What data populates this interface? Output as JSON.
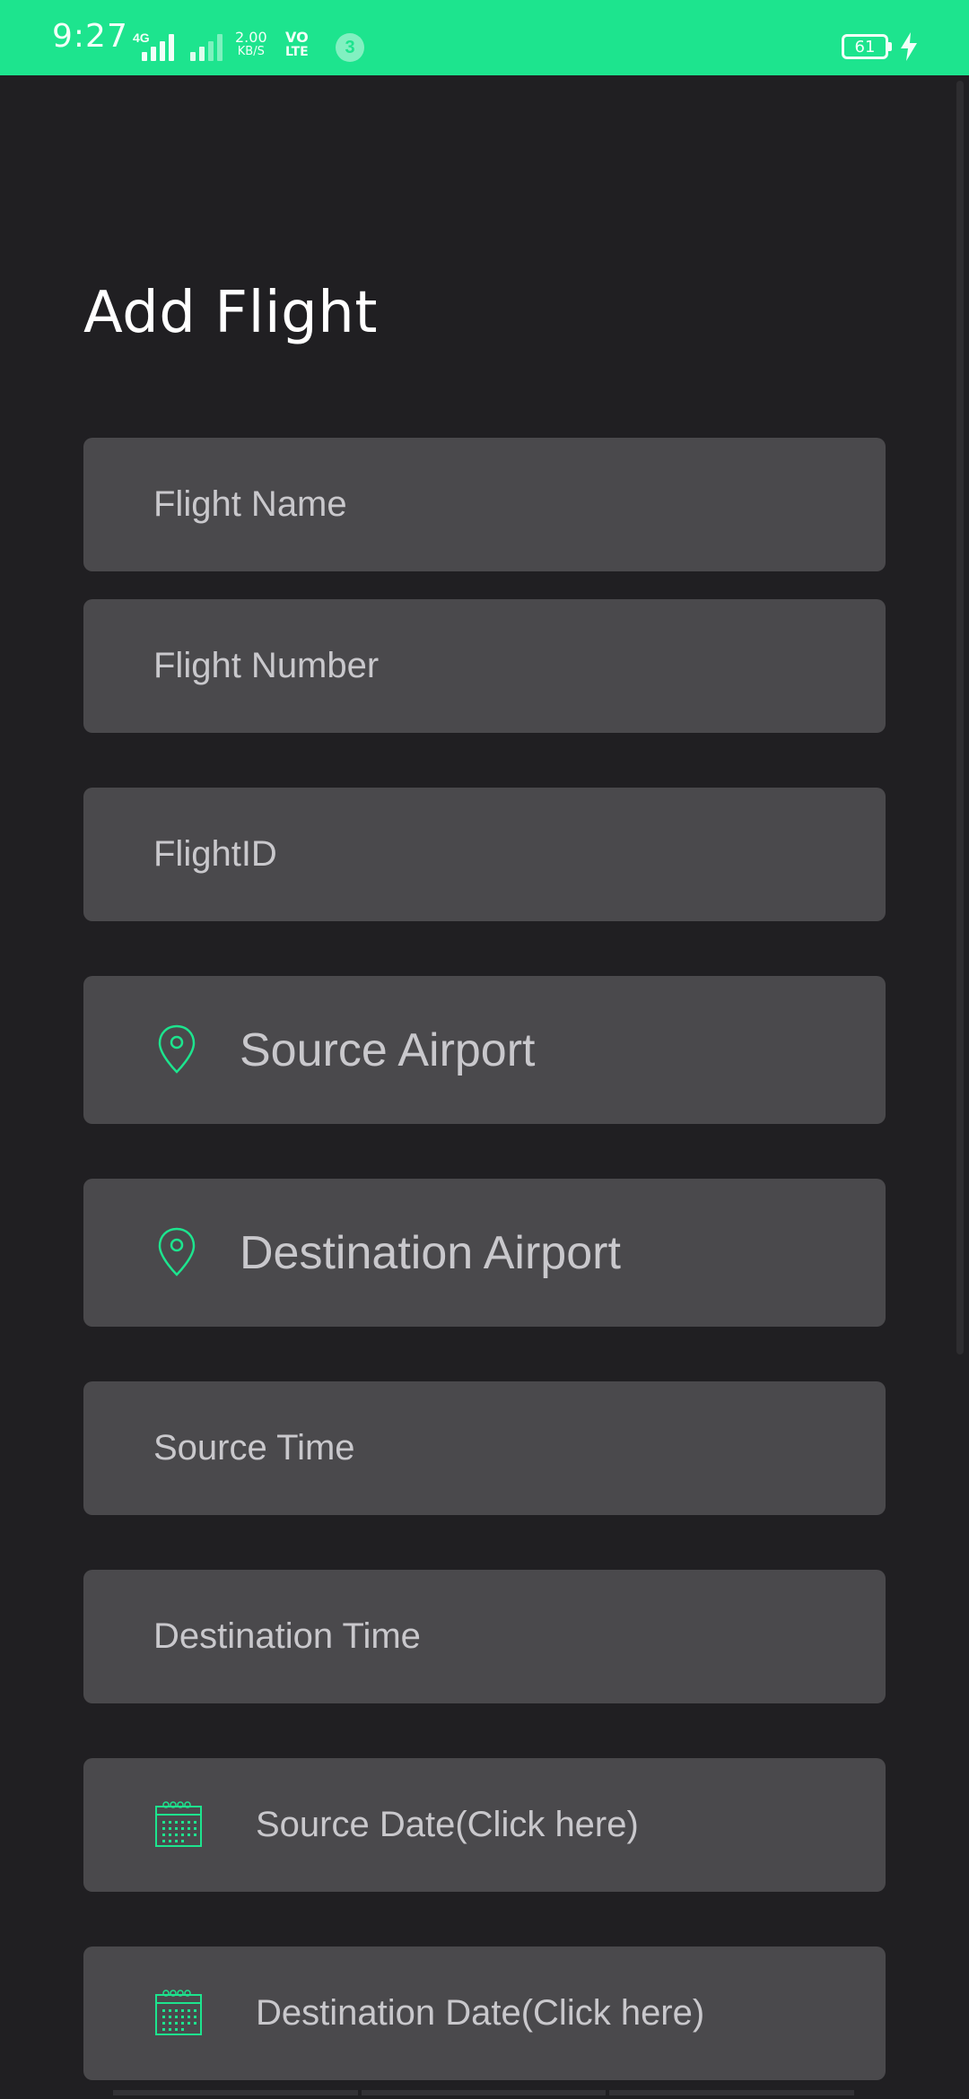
{
  "status_bar": {
    "time": "9:27",
    "network": "4G",
    "speed_value": "2.00",
    "speed_unit": "KB/S",
    "volte_top": "VO",
    "volte_bottom": "LTE",
    "notification_count": "3",
    "battery": "61",
    "accent_color": "#1de48e"
  },
  "page": {
    "title": "Add Flight"
  },
  "form": {
    "flight_name": {
      "placeholder": "Flight Name"
    },
    "flight_number": {
      "placeholder": "Flight Number"
    },
    "flight_id": {
      "placeholder": "FlightID"
    },
    "source_airport": {
      "placeholder": "Source Airport",
      "icon": "location-pin-icon"
    },
    "destination_airport": {
      "placeholder": "Destination Airport",
      "icon": "location-pin-icon"
    },
    "source_time": {
      "placeholder": "Source Time"
    },
    "destination_time": {
      "placeholder": "Destination Time"
    },
    "source_date": {
      "placeholder": "Source Date(Click here)",
      "icon": "calendar-icon"
    },
    "destination_date": {
      "placeholder": "Destination Date(Click here)",
      "icon": "calendar-icon"
    }
  },
  "colors": {
    "background": "#201f22",
    "field": "#4a494c",
    "field_text": "#c9c8cc",
    "icon": "#1de48e"
  }
}
